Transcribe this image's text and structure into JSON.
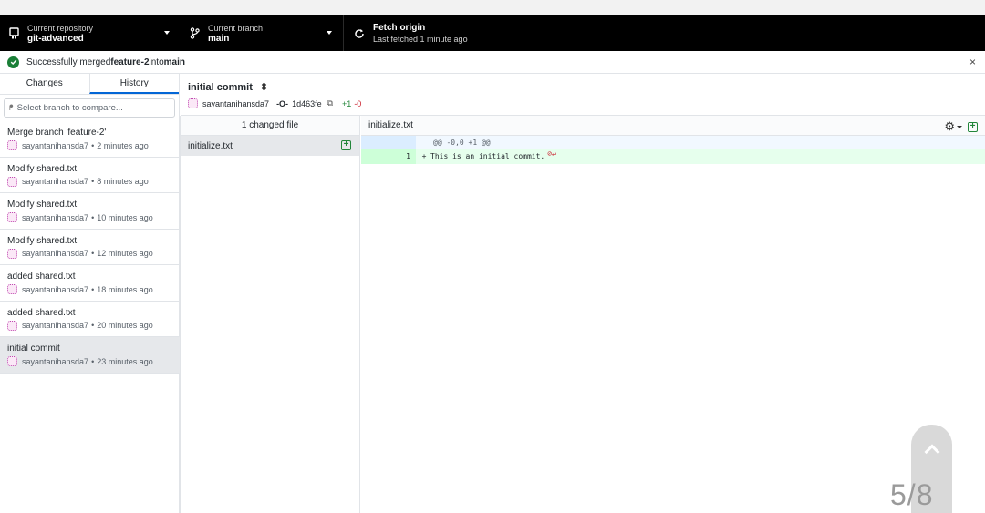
{
  "toolbar": {
    "repo": {
      "label": "Current repository",
      "value": "git-advanced"
    },
    "branch": {
      "label": "Current branch",
      "value": "main"
    },
    "fetch": {
      "label": "Fetch origin",
      "status": "Last fetched 1 minute ago"
    }
  },
  "banner": {
    "prefix": "Successfully merged ",
    "source": "feature-2",
    "middle": " into ",
    "target": "main",
    "close": "×"
  },
  "sidebar": {
    "tabs": [
      {
        "label": "Changes",
        "active": false
      },
      {
        "label": "History",
        "active": true
      }
    ],
    "branch_filter_placeholder": "Select branch to compare...",
    "commits": [
      {
        "title": "Merge branch 'feature-2'",
        "author": "sayantanihansda7",
        "time": "2 minutes ago"
      },
      {
        "title": "Modify shared.txt",
        "author": "sayantanihansda7",
        "time": "8 minutes ago"
      },
      {
        "title": "Modify shared.txt",
        "author": "sayantanihansda7",
        "time": "10 minutes ago"
      },
      {
        "title": "Modify shared.txt",
        "author": "sayantanihansda7",
        "time": "12 minutes ago"
      },
      {
        "title": "added shared.txt",
        "author": "sayantanihansda7",
        "time": "18 minutes ago"
      },
      {
        "title": "added shared.txt",
        "author": "sayantanihansda7",
        "time": "20 minutes ago"
      },
      {
        "title": "initial commit",
        "author": "sayantanihansda7",
        "time": "23 minutes ago",
        "selected": true
      }
    ],
    "meta_separator": "•"
  },
  "commit_details": {
    "title": "initial commit",
    "author": "sayantanihansda7",
    "sha": "1d463fe",
    "additions": "+1",
    "deletions": "-0"
  },
  "files": {
    "header": "1 changed file",
    "items": [
      {
        "name": "initialize.txt",
        "status": "added"
      }
    ]
  },
  "diff": {
    "filename": "initialize.txt",
    "hunk": "@@ -0,0 +1 @@",
    "lines": [
      {
        "new_no": "1",
        "sign": "+",
        "text": "This is an initial commit."
      }
    ]
  },
  "overlay": {
    "page_indicator": "5/8"
  }
}
